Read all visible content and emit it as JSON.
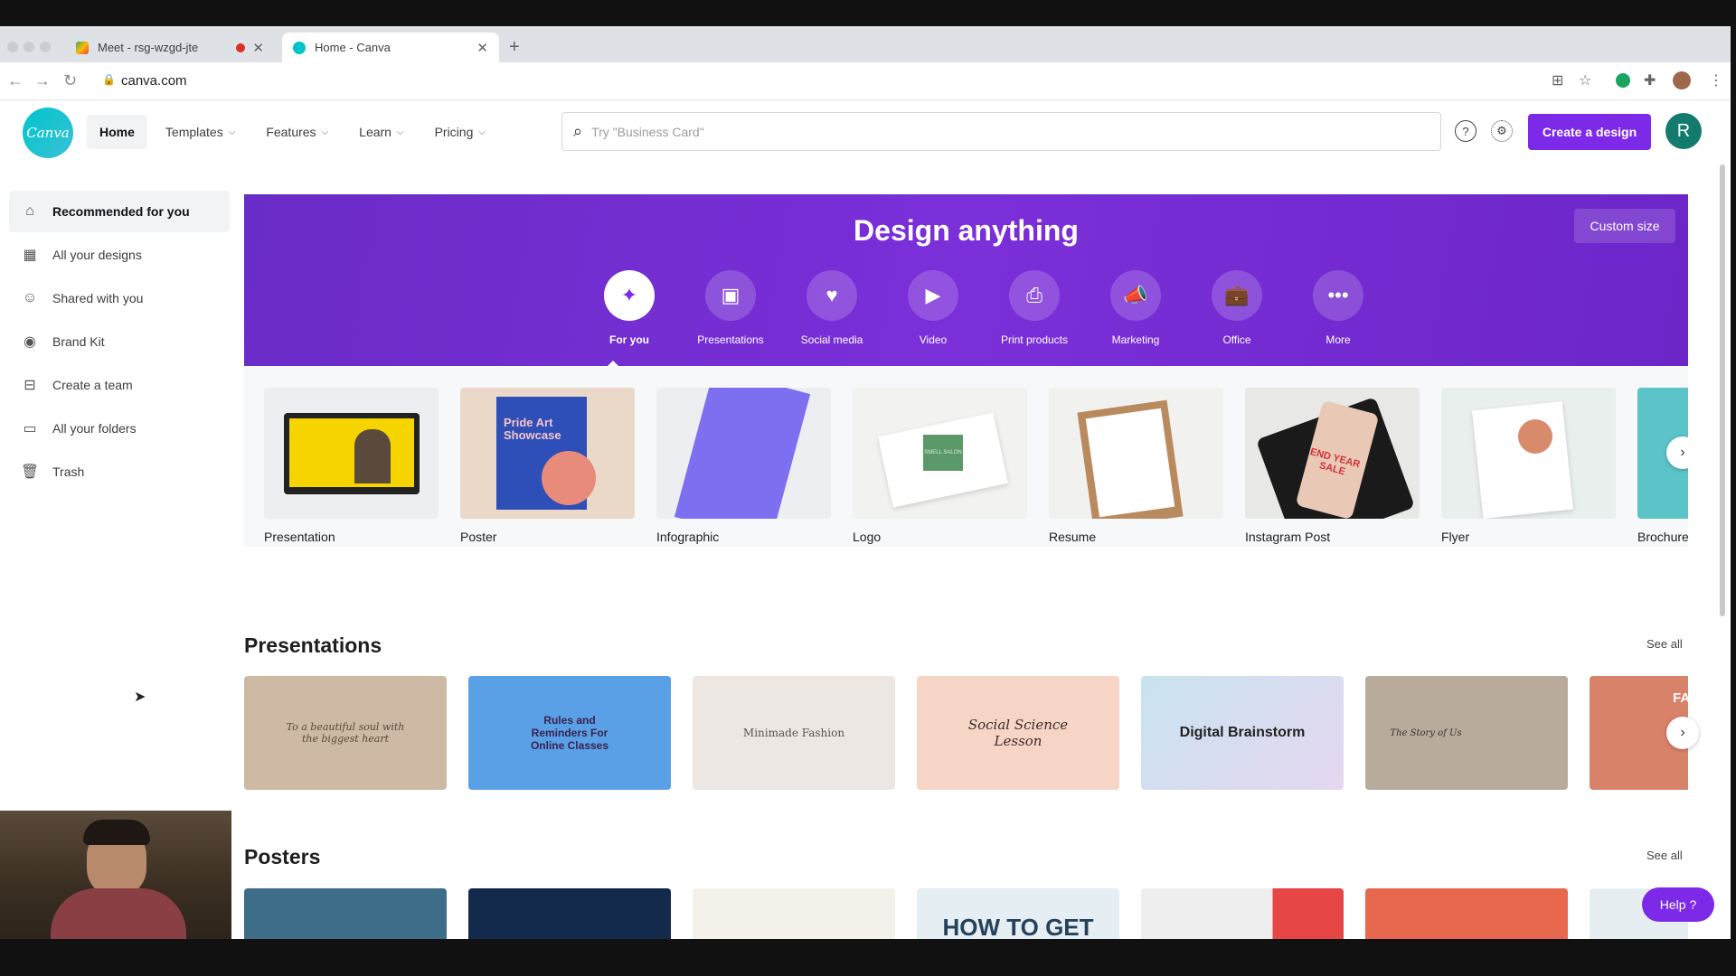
{
  "browser": {
    "tabs": [
      {
        "title": "Meet - rsg-wzgd-jte",
        "active": false
      },
      {
        "title": "Home - Canva",
        "active": true
      }
    ],
    "url": "canva.com"
  },
  "header": {
    "logo_text": "Canva",
    "nav": [
      {
        "label": "Home",
        "has_menu": false,
        "active": true
      },
      {
        "label": "Templates",
        "has_menu": true,
        "active": false
      },
      {
        "label": "Features",
        "has_menu": true,
        "active": false
      },
      {
        "label": "Learn",
        "has_menu": true,
        "active": false
      },
      {
        "label": "Pricing",
        "has_menu": true,
        "active": false
      }
    ],
    "search_placeholder": "Try \"Business Card\"",
    "create_label": "Create a design",
    "avatar_initial": "R"
  },
  "sidebar": {
    "items": [
      {
        "label": "Recommended for you",
        "icon": "home-icon",
        "active": true
      },
      {
        "label": "All your designs",
        "icon": "grid-icon",
        "active": false
      },
      {
        "label": "Shared with you",
        "icon": "people-icon",
        "active": false
      },
      {
        "label": "Brand Kit",
        "icon": "brand-icon",
        "active": false
      },
      {
        "label": "Create a team",
        "icon": "team-icon",
        "active": false
      },
      {
        "label": "All your folders",
        "icon": "folder-icon",
        "active": false
      },
      {
        "label": "Trash",
        "icon": "trash-icon",
        "active": false
      }
    ]
  },
  "banner": {
    "title": "Design anything",
    "custom_size_label": "Custom size",
    "categories": [
      {
        "label": "For you",
        "icon": "sparkle-icon",
        "active": true
      },
      {
        "label": "Presentations",
        "icon": "presentation-icon",
        "active": false
      },
      {
        "label": "Social media",
        "icon": "heart-chat-icon",
        "active": false
      },
      {
        "label": "Video",
        "icon": "video-icon",
        "active": false
      },
      {
        "label": "Print products",
        "icon": "print-icon",
        "active": false
      },
      {
        "label": "Marketing",
        "icon": "megaphone-icon",
        "active": false
      },
      {
        "label": "Office",
        "icon": "briefcase-icon",
        "active": false
      },
      {
        "label": "More",
        "icon": "more-icon",
        "active": false
      }
    ],
    "color": "#7b2fd9"
  },
  "design_types": [
    {
      "label": "Presentation"
    },
    {
      "label": "Poster",
      "thumb_text": "Pride Art Showcase"
    },
    {
      "label": "Infographic"
    },
    {
      "label": "Logo",
      "thumb_text": "SMELL SALON"
    },
    {
      "label": "Resume"
    },
    {
      "label": "Instagram Post",
      "thumb_text": "END YEAR SALE"
    },
    {
      "label": "Flyer"
    },
    {
      "label": "Brochure"
    }
  ],
  "presentations": {
    "title": "Presentations",
    "see_all": "See all",
    "cards": [
      {
        "text": "To a beautiful soul with the biggest heart"
      },
      {
        "text": "Rules and Reminders For Online Classes"
      },
      {
        "text": "Minimade Fashion"
      },
      {
        "text": "Social Science Lesson"
      },
      {
        "text": "Digital Brainstorm"
      },
      {
        "text": "The Story of Us"
      },
      {
        "text": "FACE"
      }
    ]
  },
  "posters": {
    "title": "Posters",
    "see_all": "See all",
    "cards": [
      {
        "text": ""
      },
      {
        "text": ""
      },
      {
        "text": ""
      },
      {
        "text": "HOW TO GET"
      },
      {
        "text": ""
      },
      {
        "text": ""
      },
      {
        "text": ""
      }
    ]
  },
  "help_label": "Help ?"
}
